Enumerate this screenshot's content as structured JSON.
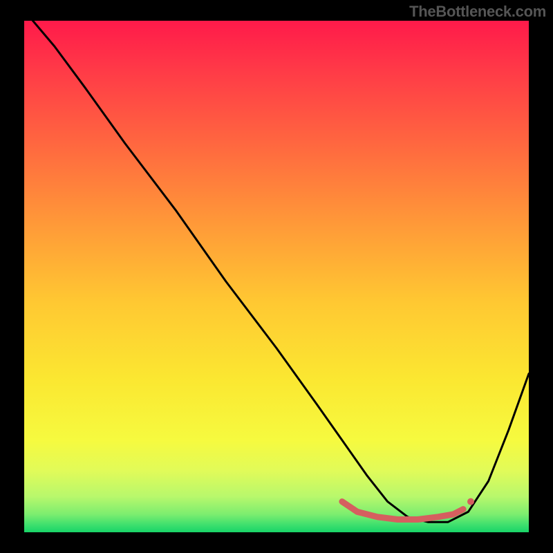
{
  "watermark": "TheBottleneck.com",
  "chart_data": {
    "type": "line",
    "title": "",
    "xlabel": "",
    "ylabel": "",
    "xlim": [
      0,
      100
    ],
    "ylim": [
      0,
      100
    ],
    "gradient_stops": [
      {
        "offset": 0,
        "color": "#ff1a4a"
      },
      {
        "offset": 0.1,
        "color": "#ff3b47"
      },
      {
        "offset": 0.25,
        "color": "#ff6a3f"
      },
      {
        "offset": 0.4,
        "color": "#ff9a38"
      },
      {
        "offset": 0.55,
        "color": "#ffc832"
      },
      {
        "offset": 0.7,
        "color": "#fbe731"
      },
      {
        "offset": 0.82,
        "color": "#f6fa3f"
      },
      {
        "offset": 0.88,
        "color": "#e1fb59"
      },
      {
        "offset": 0.93,
        "color": "#b8f86c"
      },
      {
        "offset": 0.965,
        "color": "#7ced6f"
      },
      {
        "offset": 0.985,
        "color": "#3fe06e"
      },
      {
        "offset": 1.0,
        "color": "#18d568"
      }
    ],
    "series": [
      {
        "name": "bottleneck-curve",
        "color": "#000000",
        "x": [
          0,
          6,
          12,
          20,
          30,
          40,
          50,
          58,
          63,
          68,
          72,
          76,
          80,
          84,
          88,
          92,
          96,
          100
        ],
        "y": [
          102,
          95,
          87,
          76,
          63,
          49,
          36,
          25,
          18,
          11,
          6,
          3,
          2,
          2,
          4,
          10,
          20,
          31
        ]
      }
    ],
    "optimal_band": {
      "name": "optimal-range-marker",
      "color": "#d55f5f",
      "x": [
        63,
        66,
        70,
        74,
        78,
        82,
        85,
        87
      ],
      "y": [
        6,
        4,
        3,
        2.5,
        2.5,
        3,
        3.5,
        4.5
      ]
    }
  }
}
